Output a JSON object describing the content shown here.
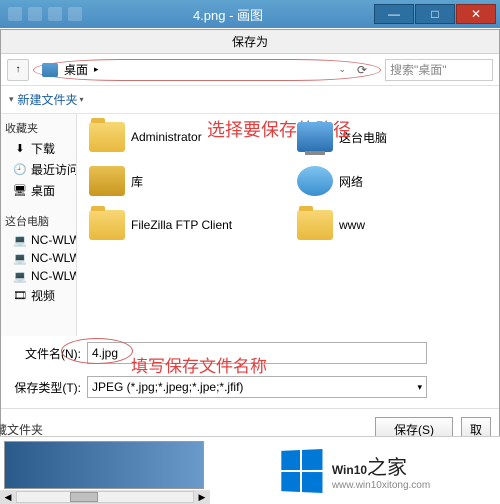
{
  "window": {
    "title": "4.png - 画图"
  },
  "dialog": {
    "title": "保存为"
  },
  "address": {
    "location": "桌面",
    "separator": "▸",
    "refresh": "⟳"
  },
  "search": {
    "placeholder": "搜索\"桌面\""
  },
  "toolbar": {
    "new_folder": "新建文件夹"
  },
  "sidebar": {
    "favorites": "收藏夹",
    "items1": [
      {
        "icon": "⬇",
        "label": "下载"
      },
      {
        "icon": "🕘",
        "label": "最近访问的位置"
      },
      {
        "icon": "🖥",
        "label": "桌面"
      }
    ],
    "thispc": "这台电脑",
    "items2": [
      {
        "icon": "💻",
        "label": "NC-WLWANG"
      },
      {
        "icon": "💻",
        "label": "NC-WLWANG"
      },
      {
        "icon": "💻",
        "label": "NC-WLWANG"
      },
      {
        "icon": "🎞",
        "label": "视频"
      }
    ]
  },
  "files": {
    "r1": [
      {
        "name": "Administrator"
      },
      {
        "name": "这台电脑"
      }
    ],
    "r2": [
      {
        "name": "库"
      },
      {
        "name": "网络"
      }
    ],
    "r3": [
      {
        "name": "FileZilla FTP Client"
      },
      {
        "name": "www"
      }
    ]
  },
  "annotations": {
    "path": "选择要保存的路径",
    "name": "填写保存文件名称"
  },
  "filename": {
    "label": "文件名(N):",
    "value": "4.jpg"
  },
  "filetype": {
    "label": "保存类型(T):",
    "value": "JPEG (*.jpg;*.jpeg;*.jpe;*.jfif)"
  },
  "buttons": {
    "hide": "藏文件夹",
    "save": "保存(S)",
    "cancel": "取"
  },
  "brand": {
    "text": "Win10之家",
    "sub": "www.win10xitong.com"
  }
}
